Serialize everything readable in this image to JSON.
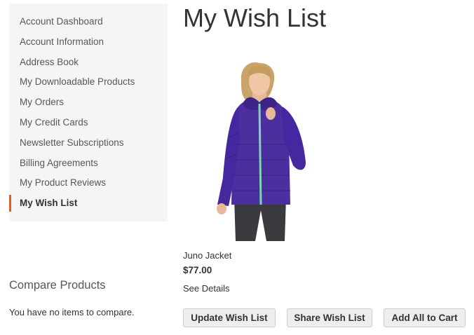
{
  "sidebar": {
    "items": [
      {
        "label": "Account Dashboard"
      },
      {
        "label": "Account Information"
      },
      {
        "label": "Address Book"
      },
      {
        "label": "My Downloadable Products"
      },
      {
        "label": "My Orders"
      },
      {
        "label": "My Credit Cards"
      },
      {
        "label": "Newsletter Subscriptions"
      },
      {
        "label": "Billing Agreements"
      },
      {
        "label": "My Product Reviews"
      },
      {
        "label": "My Wish List"
      }
    ],
    "current_index": 9,
    "accent_color": "#ff5501"
  },
  "compare": {
    "title": "Compare Products",
    "empty_text": "You have no items to compare."
  },
  "main": {
    "title": "My Wish List",
    "product": {
      "name": "Juno Jacket",
      "price": "$77.00",
      "details_link": "See Details",
      "jacket_color": "#4b2f9e",
      "zipper_color": "#7fd6b3"
    },
    "actions": {
      "update_label": "Update Wish List",
      "share_label": "Share Wish List",
      "add_all_label": "Add All to Cart"
    }
  }
}
